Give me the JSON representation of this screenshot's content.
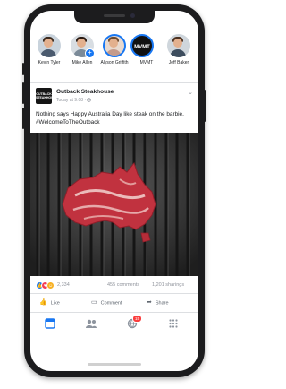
{
  "stories": [
    {
      "name": "Kevin Tyler",
      "ring": false,
      "add": false,
      "hair": "#3b2a1e",
      "shirt": "#5b6f86"
    },
    {
      "name": "Mike Allen",
      "ring": false,
      "add": true,
      "hair": "#2a1a12",
      "shirt": "#7b8a98"
    },
    {
      "name": "Alyson Griffith",
      "ring": true,
      "add": false,
      "hair": "#6b4a2e",
      "shirt": "#c49a8a"
    },
    {
      "name": "MVMT",
      "ring": true,
      "add": false,
      "logo": "MVMT"
    },
    {
      "name": "Jeff Baker",
      "ring": false,
      "add": false,
      "hair": "#4b3020",
      "shirt": "#3d4d5e"
    }
  ],
  "post": {
    "page_logo_text": "OUTBACK STEAKHOUSE",
    "page_name": "Outback Steakhouse",
    "meta": "Today at 9:08 · ",
    "privacy_icon": "globe-icon",
    "text": "Nothing says Happy Australia Day like steak on the barbie. #WelcomeToTheOutback",
    "image_subject": "steak-shaped-like-australia-on-grill"
  },
  "reactions": {
    "count": "2,334",
    "comments": "455 comments",
    "shares": "1,201 sharings"
  },
  "actions": {
    "like": "Like",
    "comment": "Comment",
    "share": "Share"
  },
  "tabbar": {
    "notification_badge": "15"
  },
  "colors": {
    "accent": "#1877f2",
    "like_blue": "#1877f2",
    "love_red": "#f33e58",
    "haha_yellow": "#f7b125",
    "badge_red": "#fa3e3e",
    "steak": "#c1323f"
  }
}
